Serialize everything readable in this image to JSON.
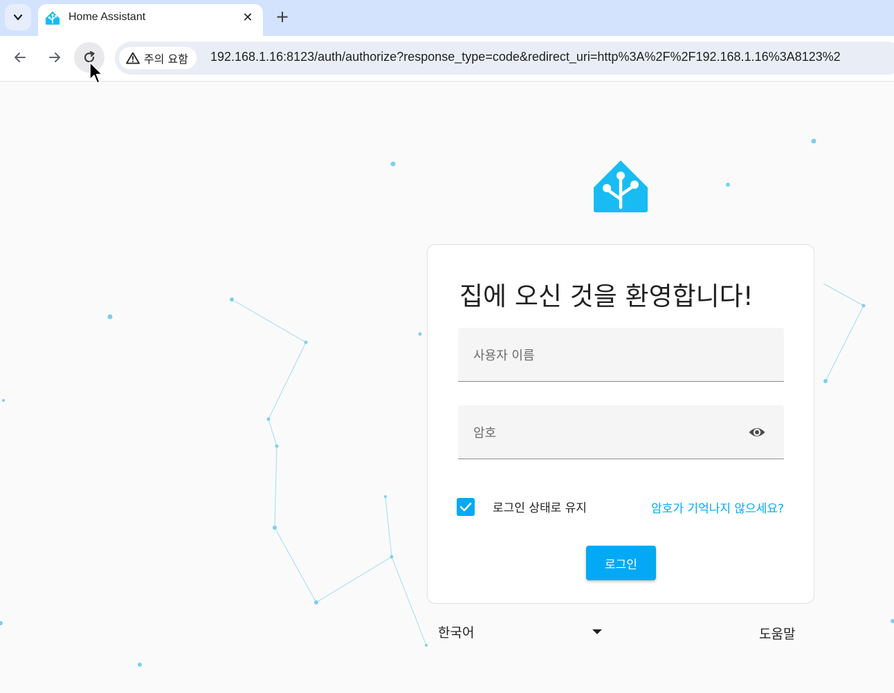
{
  "browser": {
    "tab_title": "Home Assistant",
    "tab_close_glyph": "✕",
    "new_tab_glyph": "+",
    "security_label": "주의 요함",
    "url": "192.168.1.16:8123/auth/authorize?response_type=code&redirect_uri=http%3A%2F%2F192.168.1.16%3A8123%2"
  },
  "login": {
    "title": "집에 오신 것을 환영합니다!",
    "username_label": "사용자 이름",
    "password_label": "암호",
    "remember_label": "로그인 상태로 유지",
    "remember_checked": true,
    "forgot_link": "암호가 기억나지 않으세요?",
    "login_button": "로그인"
  },
  "footer": {
    "language": "한국어",
    "help": "도움말"
  },
  "colors": {
    "accent": "#03a9f4",
    "tab_strip": "#d3e3fd",
    "background": "#fafafa",
    "constellation": "#7fcdf0"
  },
  "icons": {
    "tab_favicon": "home-assistant-icon",
    "security": "warning-triangle-icon",
    "password_toggle": "eye-icon",
    "checkbox": "check-icon",
    "language_dropdown": "caret-down-icon"
  }
}
